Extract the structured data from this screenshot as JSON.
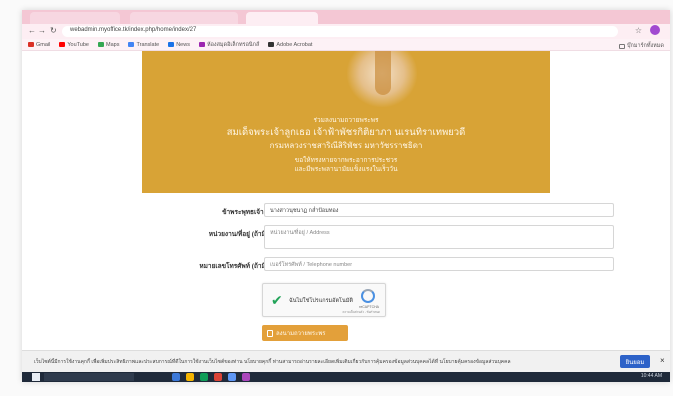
{
  "browser": {
    "tabs": [
      {
        "label": "",
        "active": false
      },
      {
        "label": "",
        "active": false
      },
      {
        "label": "",
        "active": true
      }
    ],
    "url": "webadmin.myoffice.tk/index.php/home/index/27",
    "bookmarks": [
      {
        "label": "Gmail",
        "color": "#d93025"
      },
      {
        "label": "YouTube",
        "color": "#ff0000"
      },
      {
        "label": "Maps",
        "color": "#34a853"
      },
      {
        "label": "Translate",
        "color": "#4285f4"
      },
      {
        "label": "News",
        "color": "#1a73e8"
      },
      {
        "label": "ห้องสมุดอิเล็กทรอนิกส์",
        "color": "#9c27b0"
      },
      {
        "label": "Adobe Acrobat",
        "color": "#333333"
      }
    ],
    "all_bookmarks": "บุ๊กมาร์กทั้งหมด"
  },
  "banner": {
    "line1": "ร่วมลงนามถวายพระพร",
    "line2": "สมเด็จพระเจ้าลูกเธอ เจ้าฟ้าพัชรกิติยาภา นเรนทิราเทพยวดี",
    "line3": "กรมหลวงราชสาริณีสิริพัชร มหาวัชรราชธิดา",
    "line4": "ขอให้ทรงหายจากพระอาการประชวร",
    "line5": "และมีพระพลานามัยแข็งแรงในเร็ววัน",
    "color": "#d8a336"
  },
  "form": {
    "name_label": "ข้าพระพุทธเจ้า *",
    "name_value": "นางสาวนุชนาฏ กล่ำป้อมทอง",
    "org_label": "หน่วยงาน/ที่อยู่ (ถ้ามี)",
    "org_placeholder": "หน่วยงาน/ที่อยู่ / Address",
    "phone_label": "หมายเลขโทรศัพท์ (ถ้ามี)",
    "phone_placeholder": "เบอร์โทรศัพท์ / Telephone number",
    "captcha_text": "ฉันไม่ใช่โปรแกรมอัตโนมัติ",
    "captcha_brand": "reCAPTCHA",
    "captcha_terms": "ความเป็นส่วนตัว - ข้อกำหนด",
    "submit_label": "ลงนามถวายพระพร",
    "submit_color": "#e3a03a"
  },
  "cookie": {
    "text": "เว็บไซต์นี้มีการใช้งานคุกกี้ เพื่อเพิ่มประสิทธิภาพและประสบการณ์ที่ดีในการใช้งานเว็บไซต์ของท่าน นโยบายคุกกี้ ท่านสามารถอ่านรายละเอียดเพิ่มเติมเกี่ยวกับการคุ้มครองข้อมูลส่วนบุคคลได้ที่ นโยบายคุ้มครองข้อมูลส่วนบุคคล",
    "accept_label": "ยินยอม",
    "accept_color": "#2d62c8",
    "close_label": "×"
  },
  "taskbar": {
    "clock": "10:44 AM"
  }
}
